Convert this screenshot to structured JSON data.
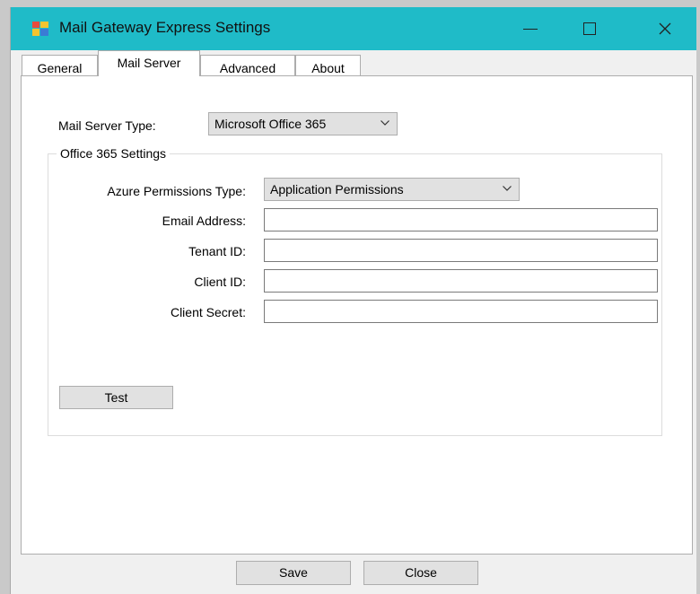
{
  "window": {
    "title": "Mail Gateway Express Settings"
  },
  "tabs": [
    "General",
    "Mail Server",
    "Advanced",
    "About"
  ],
  "mail_server": {
    "type_label": "Mail Server Type:",
    "type_value": "Microsoft Office 365",
    "group_title": "Office 365 Settings",
    "azure_label": "Azure Permissions Type:",
    "azure_value": "Application Permissions",
    "email_label": "Email Address:",
    "email_value": "",
    "tenant_label": "Tenant ID:",
    "tenant_value": "",
    "client_label": "Client ID:",
    "client_value": "",
    "secret_label": "Client Secret:",
    "secret_value": "",
    "test_label": "Test"
  },
  "footer": {
    "save_label": "Save",
    "close_label": "Close"
  },
  "icons": {
    "app": "mail-gateway-app-icon",
    "min": "minimize-icon",
    "max": "maximize-icon",
    "close": "close-icon",
    "dropdown": "chevron-down-icon"
  },
  "colors": {
    "titlebar": "#1fbbc8"
  }
}
